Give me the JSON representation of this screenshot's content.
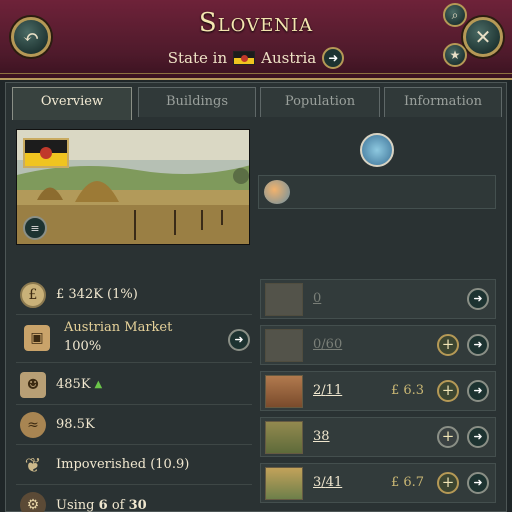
{
  "header": {
    "title": "Slovenia",
    "state_prefix": "State in",
    "owner": "Austria"
  },
  "tabs": [
    {
      "label": "Overview",
      "active": true
    },
    {
      "label": "Buildings",
      "active": false
    },
    {
      "label": "Population",
      "active": false
    },
    {
      "label": "Information",
      "active": false
    }
  ],
  "stats": {
    "gdp": "£ 342K (1%)",
    "market_name": "Austrian Market",
    "market_pct": "100%",
    "population": "485K",
    "arable": "98.5K",
    "standard_of_living": "Impoverished (10.9)",
    "using_prefix": "Using",
    "using_n": "6",
    "using_of": "of",
    "using_total": "30"
  },
  "buildings": [
    {
      "count": "0",
      "total": "",
      "money": "",
      "has_plus": false
    },
    {
      "count": "0",
      "total": "60",
      "money": "",
      "has_plus": true
    },
    {
      "count": "2",
      "total": "11",
      "money": "£ 6.3",
      "has_plus": true
    },
    {
      "count": "38",
      "total": "",
      "money": "",
      "has_plus": true
    },
    {
      "count": "3",
      "total": "41",
      "money": "£ 6.7",
      "has_plus": true
    }
  ],
  "colors": {
    "header": "#5a1d31",
    "gold": "#b59956",
    "panel": "#2a3233"
  }
}
